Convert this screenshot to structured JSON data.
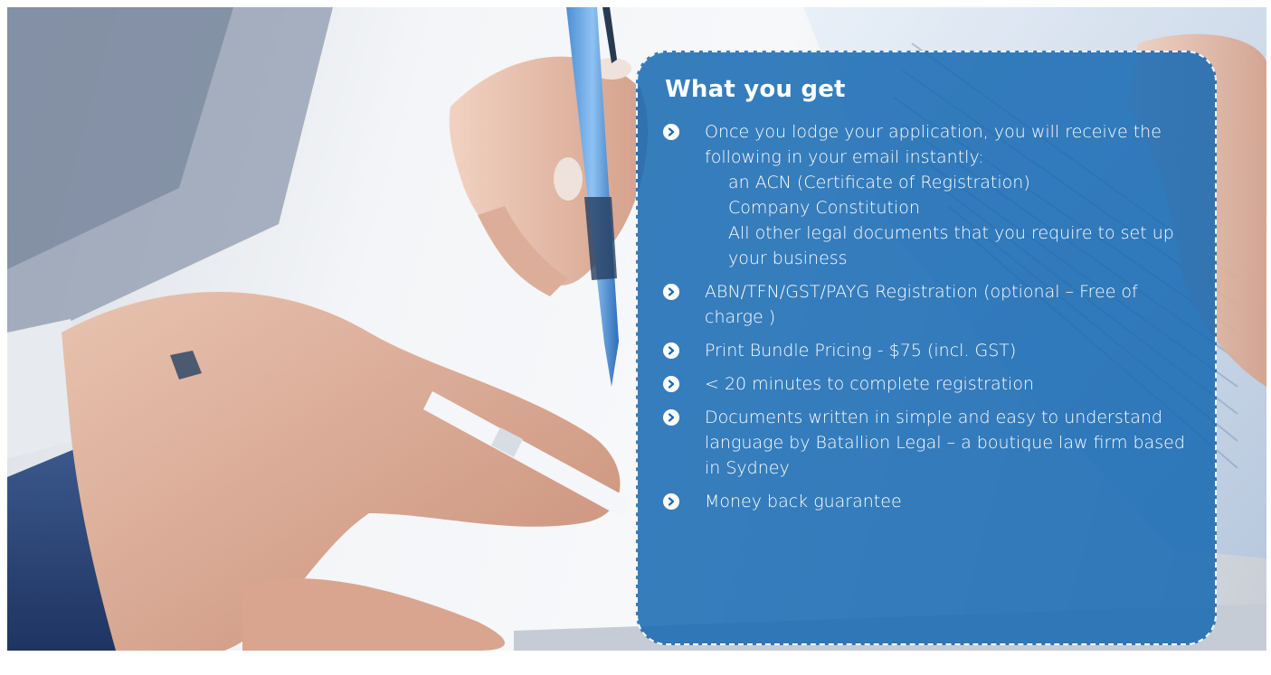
{
  "card": {
    "title": "What you get",
    "items": [
      {
        "text": "Once you lodge your application, you will receive the following in your email instantly:",
        "sub_items": [
          "an ACN (Certificate of Registration)",
          "Company Constitution",
          "All other legal documents that you require to set up your business"
        ]
      },
      {
        "text": "ABN/TFN/GST/PAYG Registration (optional – Free of charge )"
      },
      {
        "text": "Print Bundle Pricing - $75 (incl. GST)"
      },
      {
        "text": "< 20 minutes to complete registration"
      },
      {
        "text": "Documents written in simple and easy to understand language by Batallion Legal – a boutique law firm based in Sydney"
      },
      {
        "text": "Money back guarantee"
      }
    ]
  },
  "icons": {
    "bullet": "chevron-right-circle-icon",
    "bullet_color": "#ffffff",
    "bullet_chevron_color": "#1669b2"
  },
  "colors": {
    "card_background": "#1669b2",
    "card_text": "#ffffff"
  }
}
